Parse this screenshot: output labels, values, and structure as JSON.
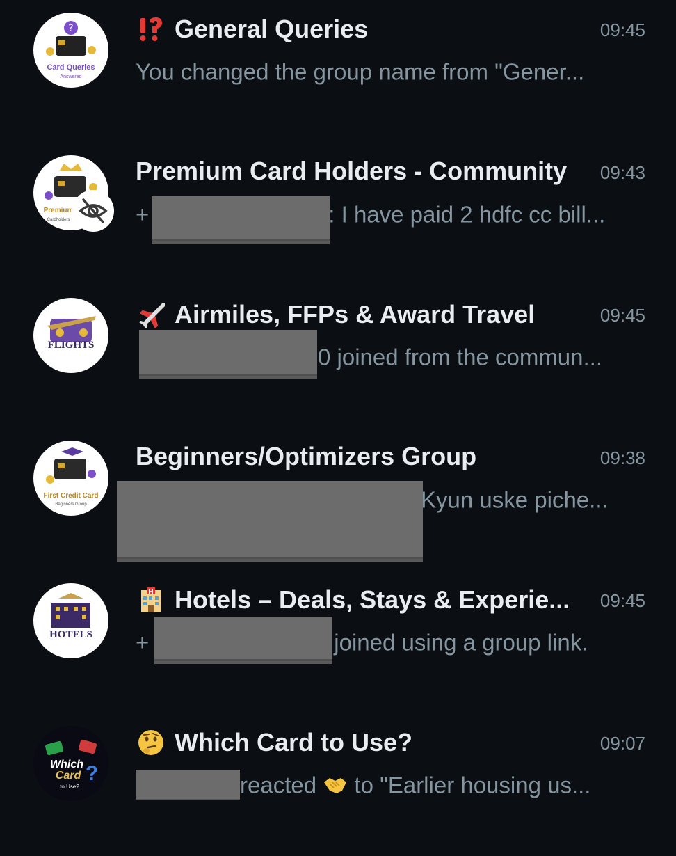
{
  "chats": [
    {
      "name": "General Queries",
      "emoji_icon": "exclamation-question-icon",
      "time": "09:45",
      "preview_before": "",
      "preview_after": "You changed the group name from \"Gener...",
      "avatar_caption": "Card Queries",
      "avatar_subcaption": "Answered"
    },
    {
      "name": "Premium Card Holders - Community",
      "emoji_icon": "",
      "time": "09:43",
      "preview_before": "+",
      "preview_after": ": I have paid 2 hdfc cc bill...",
      "avatar_caption": "Premium",
      "avatar_subcaption": "Cardholders"
    },
    {
      "name": "Airmiles, FFPs & Award Travel",
      "emoji_icon": "airplane-icon",
      "time": "09:45",
      "preview_before": "",
      "preview_after": "0 joined from the commun...",
      "avatar_caption": "FLIGHTS",
      "avatar_subcaption": ""
    },
    {
      "name": "Beginners/Optimizers Group",
      "emoji_icon": "",
      "time": "09:38",
      "preview_before": "",
      "preview_after": "Kyun uske piche...",
      "avatar_caption": "First Credit Card",
      "avatar_subcaption": "Beginners Group"
    },
    {
      "name": "Hotels – Deals, Stays & Experie...",
      "emoji_icon": "hotel-icon",
      "time": "09:45",
      "preview_before": "+",
      "preview_after": "joined using a group link.",
      "avatar_caption": "HOTELS",
      "avatar_subcaption": ""
    },
    {
      "name": "Which Card to Use?",
      "emoji_icon": "thinking-face-icon",
      "time": "09:07",
      "preview_before": "",
      "preview_mid": "reacted",
      "preview_after": "to \"Earlier housing us...",
      "avatar_caption": "Which Card to Use?",
      "avatar_subcaption": ""
    }
  ]
}
